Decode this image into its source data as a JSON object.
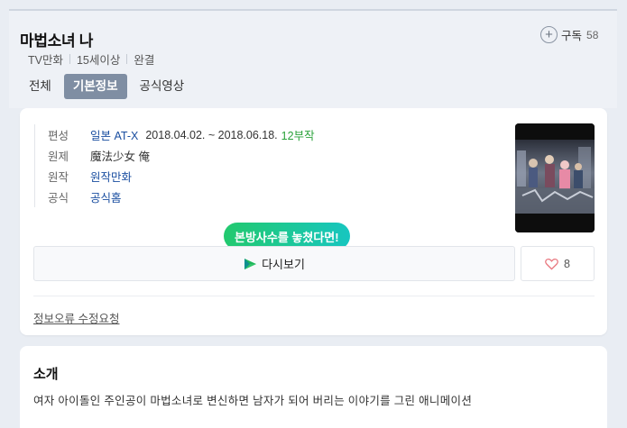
{
  "header": {
    "title": "마법소녀 나",
    "meta": [
      "TV만화",
      "15세이상",
      "완결"
    ],
    "subscribe_label": "구독",
    "subscribe_count": "58"
  },
  "tabs": [
    {
      "label": "전체",
      "active": false
    },
    {
      "label": "기본정보",
      "active": true
    },
    {
      "label": "공식영상",
      "active": false
    }
  ],
  "info": {
    "broadcast": {
      "key": "편성",
      "channel": "일본 AT-X",
      "dates": "2018.04.02. ~ 2018.06.18.",
      "episodes": "12부작"
    },
    "original": {
      "key": "원제",
      "value": "魔法少女 俺"
    },
    "source": {
      "key": "원작",
      "value": "원작만화"
    },
    "official": {
      "key": "공식",
      "value": "공식홈"
    }
  },
  "tooltip": "본방사수를 놓쳤다면!",
  "rewatch_label": "다시보기",
  "like_count": "8",
  "report_label": "정보오류 수정요청",
  "intro": {
    "title": "소개",
    "text": "여자 아이돌인 주인공이 마법소녀로 변신하면 남자가 되어 버리는 이야기를 그린 애니메이션"
  },
  "colors": {
    "link": "#1a4ea0",
    "episodes": "#2aa23a",
    "tab_active_bg": "#7f8ea3",
    "tooltip_gradient": [
      "#22c96e",
      "#17c6c0"
    ],
    "heart": "#e8747c"
  }
}
